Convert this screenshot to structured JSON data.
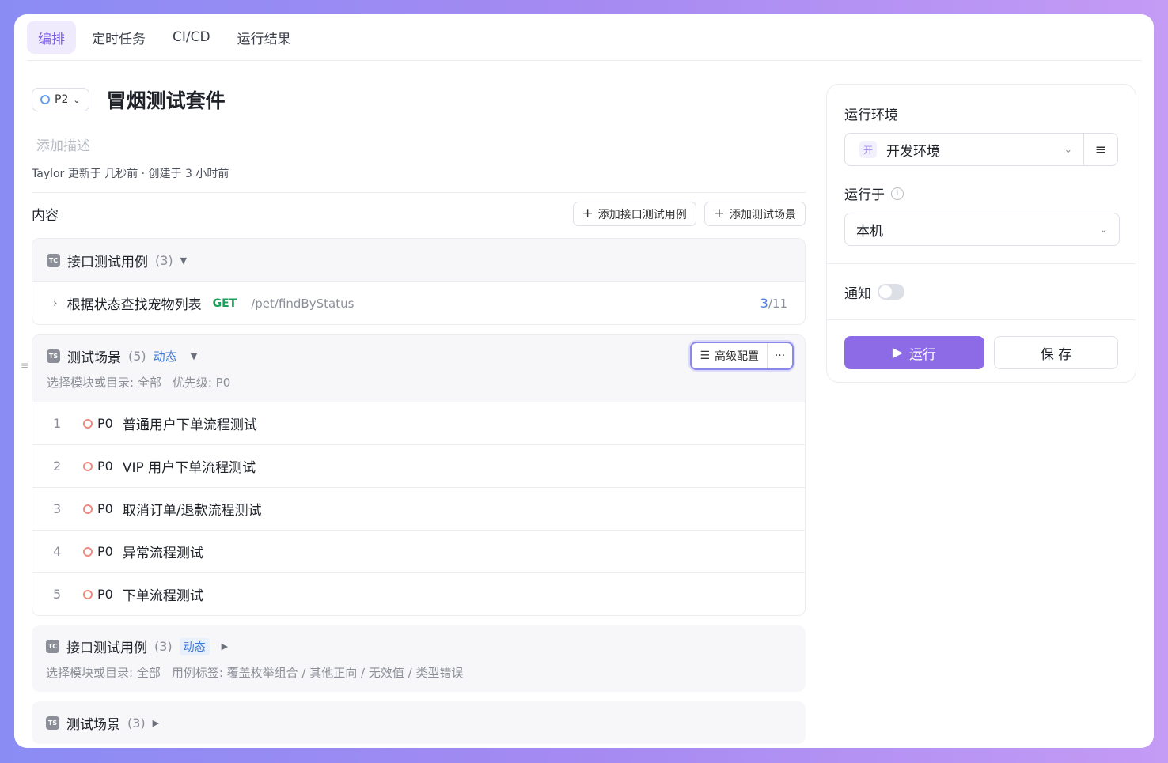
{
  "tabs": [
    {
      "label": "编排",
      "active": true
    },
    {
      "label": "定时任务",
      "active": false
    },
    {
      "label": "CI/CD",
      "active": false
    },
    {
      "label": "运行结果",
      "active": false
    }
  ],
  "header": {
    "priority": "P2",
    "title": "冒烟测试套件",
    "description_placeholder": "添加描述",
    "meta": "Taylor 更新于 几秒前 · 创建于 3 小时前"
  },
  "content": {
    "title": "内容",
    "add_api_case": "添加接口测试用例",
    "add_scenario": "添加测试场景"
  },
  "groups": [
    {
      "icon": "TC",
      "title": "接口测试用例",
      "count": "(3)",
      "items": [
        {
          "name": "根据状态查找宠物列表",
          "method": "GET",
          "path": "/pet/findByStatus",
          "progress_current": "3",
          "progress_total": "/11"
        }
      ]
    },
    {
      "icon": "TS",
      "title": "测试场景",
      "count": "(5)",
      "dynamic": "动态",
      "filter_module": "选择模块或目录: 全部",
      "filter_priority": "优先级: P0",
      "advanced": "高级配置",
      "scenes": [
        {
          "num": "1",
          "prio": "P0",
          "name": "普通用户下单流程测试"
        },
        {
          "num": "2",
          "prio": "P0",
          "name": "VIP 用户下单流程测试"
        },
        {
          "num": "3",
          "prio": "P0",
          "name": "取消订单/退款流程测试"
        },
        {
          "num": "4",
          "prio": "P0",
          "name": "异常流程测试"
        },
        {
          "num": "5",
          "prio": "P0",
          "name": "下单流程测试"
        }
      ]
    },
    {
      "icon": "TC",
      "title": "接口测试用例",
      "count": "(3)",
      "dynamic": "动态",
      "filter_module": "选择模块或目录: 全部",
      "filter_tags": "用例标签: 覆盖枚举组合 / 其他正向 / 无效值 / 类型错误"
    },
    {
      "icon": "TS",
      "title": "测试场景",
      "count": "(3)"
    }
  ],
  "panel": {
    "env_label": "运行环境",
    "env_badge": "开",
    "env_value": "开发环境",
    "runner_label": "运行于",
    "runner_value": "本机",
    "notify_label": "通知",
    "notify_on": false,
    "run": "运行",
    "save": "保 存"
  },
  "colors": {
    "accent": "#8e6be6",
    "method_get": "#1ba25a",
    "link": "#3d7ad8",
    "priority_p0": "#ef8a82"
  }
}
